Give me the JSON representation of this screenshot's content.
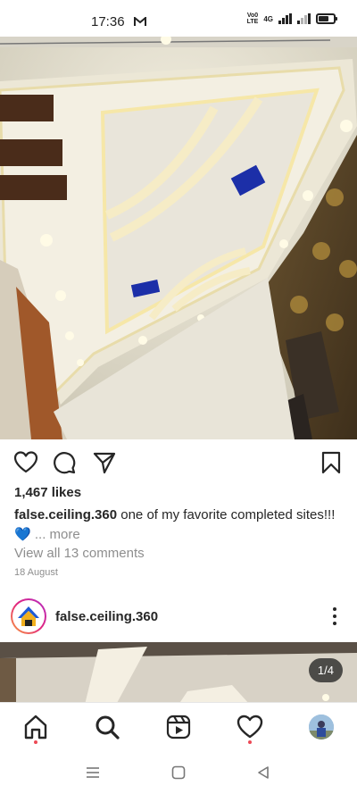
{
  "status_bar": {
    "time": "17:36",
    "network_label_top": "Vo0",
    "network_label_bottom": "LTE",
    "network_type": "4G",
    "battery_level": 0.7
  },
  "post": {
    "likes": "1,467 likes",
    "username": "false.ceiling.360",
    "caption_text": "one of my favorite completed sites!!!",
    "caption_emoji": "💙",
    "more_label": "... more",
    "view_comments": "View all 13 comments",
    "date": "18 August"
  },
  "next_post": {
    "username": "false.ceiling.360",
    "page_indicator": "1/4"
  },
  "icons": {
    "like": "heart-icon",
    "comment": "comment-icon",
    "share": "send-icon",
    "save": "bookmark-icon",
    "more": "more-options-icon",
    "home": "home-icon",
    "search": "search-icon",
    "reels": "reels-icon",
    "activity": "heart-icon",
    "profile": "avatar"
  },
  "colors": {
    "notification_dot": "#ed4956",
    "heart_emoji": "#3897f0"
  }
}
